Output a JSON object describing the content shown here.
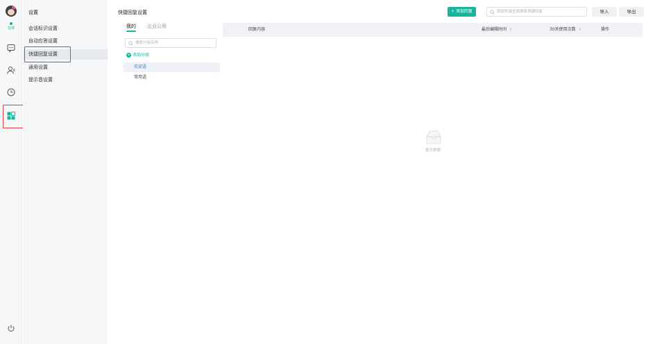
{
  "rail": {
    "status": "在线",
    "icons": [
      "avatar",
      "chat-bubble-icon",
      "user-group-icon",
      "clock-icon",
      "apps-grid-icon",
      "power-icon"
    ],
    "accent": "#16b39d"
  },
  "subnav": {
    "title": "设置",
    "items": [
      {
        "label": "会话标识设置"
      },
      {
        "label": "自动应答设置"
      },
      {
        "label": "快捷回复设置"
      },
      {
        "label": "通用设置"
      },
      {
        "label": "提示音设置"
      }
    ]
  },
  "header": {
    "title": "快捷回复设置",
    "add_button": "+ 添加回复",
    "search_placeholder": "按回车键全局搜索快捷回复",
    "import_button": "导入",
    "export_button": "导出"
  },
  "groups": {
    "tabs": [
      {
        "label": "我的"
      },
      {
        "label": "企业公用"
      }
    ],
    "search_placeholder": "搜索分组名称",
    "add_group": "添加分组",
    "items": [
      {
        "label": "欢迎语"
      },
      {
        "label": "常用语"
      }
    ]
  },
  "table": {
    "columns": [
      {
        "label": "回复内容"
      },
      {
        "label": "最后编辑时间"
      },
      {
        "label": "30天使用次数"
      },
      {
        "label": "操作"
      }
    ],
    "empty_text": "暂无数据"
  }
}
